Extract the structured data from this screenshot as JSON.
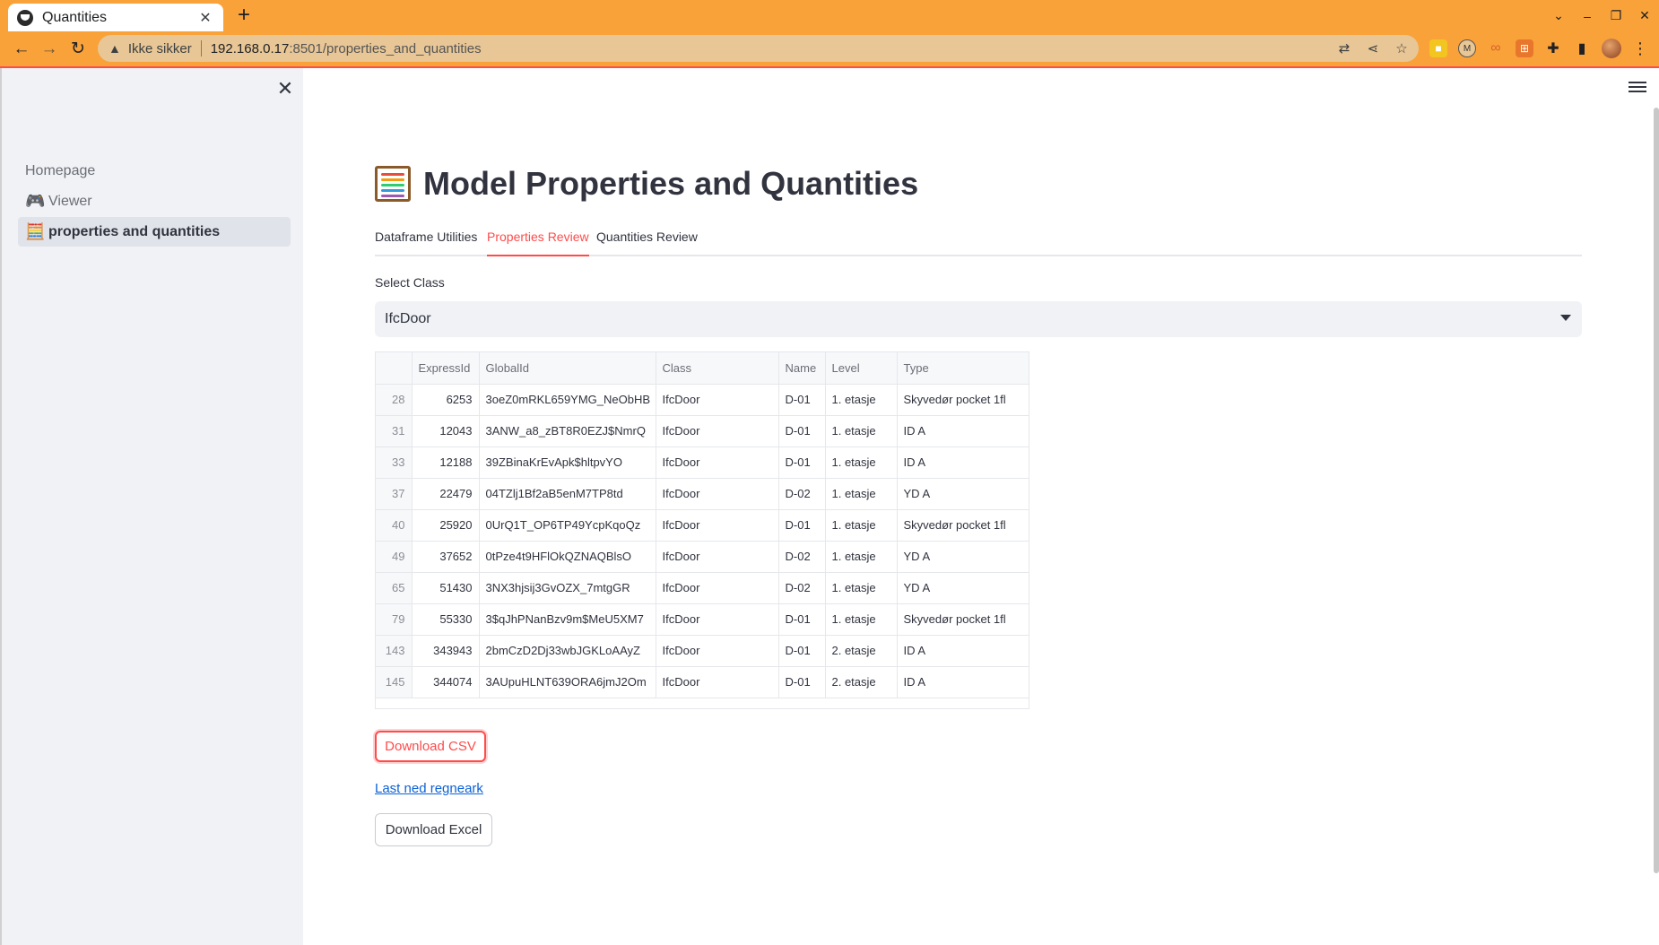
{
  "browser": {
    "tab_title": "Quantities",
    "security_label": "Ikke sikker",
    "url_host": "192.168.0.17",
    "url_path": ":8501/properties_and_quantities",
    "accent_color": "#f9a23a"
  },
  "sidebar": {
    "items": [
      {
        "label": "Homepage",
        "icon": ""
      },
      {
        "label": "Viewer",
        "icon": "gamepad-icon"
      },
      {
        "label": "properties and quantities",
        "icon": "abacus-icon"
      }
    ],
    "active_index": 2
  },
  "main": {
    "title": "Model Properties and Quantities",
    "title_icon": "abacus-icon",
    "tabs": [
      "Dataframe Utilities",
      "Properties Review",
      "Quantities Review"
    ],
    "active_tab": 1,
    "select": {
      "label": "Select Class",
      "value": "IfcDoor"
    }
  },
  "table": {
    "columns": [
      "",
      "ExpressId",
      "GlobalId",
      "Class",
      "Name",
      "Level",
      "Type"
    ],
    "rows": [
      [
        "28",
        "6253",
        "3oeZ0mRKL659YMG_NeObHB",
        "IfcDoor",
        "D-01",
        "1. etasje",
        "Skyvedør pocket 1fl"
      ],
      [
        "31",
        "12043",
        "3ANW_a8_zBT8R0EZJ$NmrQ",
        "IfcDoor",
        "D-01",
        "1. etasje",
        "ID A"
      ],
      [
        "33",
        "12188",
        "39ZBinaKrEvApk$hltpvYO",
        "IfcDoor",
        "D-01",
        "1. etasje",
        "ID A"
      ],
      [
        "37",
        "22479",
        "04TZlj1Bf2aB5enM7TP8td",
        "IfcDoor",
        "D-02",
        "1. etasje",
        "YD A"
      ],
      [
        "40",
        "25920",
        "0UrQ1T_OP6TP49YcpKqoQz",
        "IfcDoor",
        "D-01",
        "1. etasje",
        "Skyvedør pocket 1fl"
      ],
      [
        "49",
        "37652",
        "0tPze4t9HFlOkQZNAQBlsO",
        "IfcDoor",
        "D-02",
        "1. etasje",
        "YD A"
      ],
      [
        "65",
        "51430",
        "3NX3hjsij3GvOZX_7mtgGR",
        "IfcDoor",
        "D-02",
        "1. etasje",
        "YD A"
      ],
      [
        "79",
        "55330",
        "3$qJhPNanBzv9m$MeU5XM7",
        "IfcDoor",
        "D-01",
        "1. etasje",
        "Skyvedør pocket 1fl"
      ],
      [
        "143",
        "343943",
        "2bmCzD2Dj33wbJGKLoAAyZ",
        "IfcDoor",
        "D-01",
        "2. etasje",
        "ID A"
      ],
      [
        "145",
        "344074",
        "3AUpuHLNT639ORA6jmJ2Om",
        "IfcDoor",
        "D-01",
        "2. etasje",
        "ID A"
      ]
    ]
  },
  "actions": {
    "download_csv": "Download CSV",
    "download_sheet_link": "Last ned regneark",
    "download_excel": "Download Excel"
  }
}
